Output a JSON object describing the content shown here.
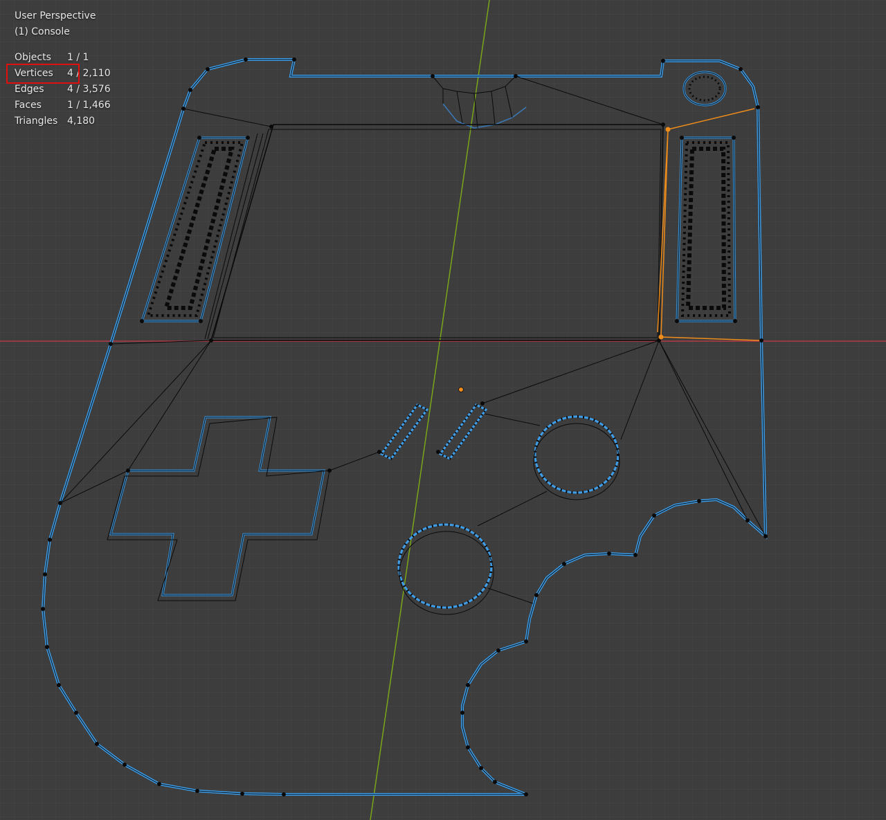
{
  "viewport": {
    "view_name": "User Perspective",
    "object_name": "(1) Console",
    "stats": [
      {
        "label": "Objects",
        "value": "1 / 1"
      },
      {
        "label": "Vertices",
        "value": "4 / 2,110"
      },
      {
        "label": "Edges",
        "value": "4 / 3,576"
      },
      {
        "label": "Faces",
        "value": "1 / 1,466"
      },
      {
        "label": "Triangles",
        "value": "4,180"
      }
    ],
    "highlighted_stat": "Vertices"
  },
  "colors": {
    "background": "#3d3d3d",
    "grid": "#474747",
    "x_axis": "#b33a46",
    "y_axis": "#7aa61a",
    "edge": "#0a0a0a",
    "boundary": "#3d9de8",
    "selection": "#f08c1a",
    "highlight_box": "#e01010"
  }
}
